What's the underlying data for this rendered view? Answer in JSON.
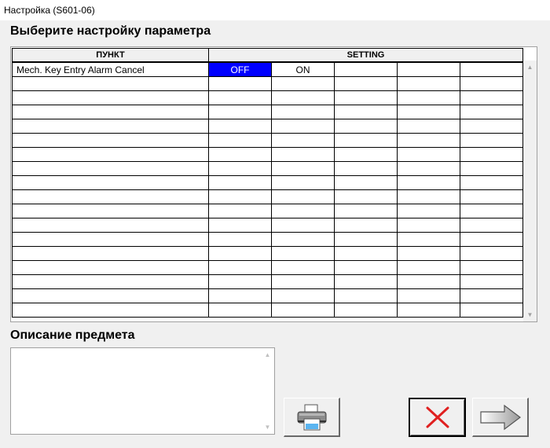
{
  "window": {
    "title": "Настройка (S601-06)"
  },
  "main": {
    "heading": "Выберите настройку параметра"
  },
  "grid": {
    "headers": {
      "item": "ПУНКТ",
      "setting": "SETTING"
    },
    "rows": [
      {
        "item": "Mech. Key Entry Alarm Cancel",
        "options": [
          "OFF",
          "ON",
          "",
          "",
          ""
        ],
        "selected_index": 0
      }
    ],
    "total_rows": 18
  },
  "description": {
    "heading": "Описание предмета",
    "text": ""
  },
  "buttons": [
    {
      "name": "print-button",
      "icon": "printer-icon"
    },
    {
      "name": "cancel-button",
      "icon": "red-x-icon"
    },
    {
      "name": "next-button",
      "icon": "arrow-right-icon"
    }
  ],
  "colors": {
    "selection": "#0000ff",
    "cancel_x": "#e02020"
  }
}
